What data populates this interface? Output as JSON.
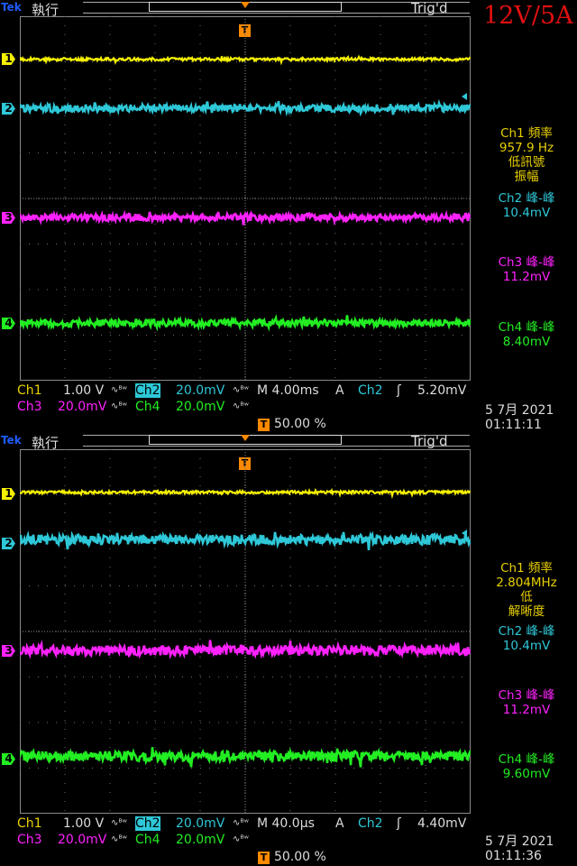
{
  "screens": [
    {
      "brand": "Tek",
      "acq_state": "執行",
      "trigger_state": "Trig'd",
      "rating_label": "12V/5A",
      "channels": [
        {
          "num": "1",
          "color": "#f5f000",
          "level": 0.118
        },
        {
          "num": "2",
          "color": "#2ec8d8",
          "level": 0.252
        },
        {
          "num": "3",
          "color": "#ff22ff",
          "level": 0.552
        },
        {
          "num": "4",
          "color": "#22ee22",
          "level": 0.842
        }
      ],
      "measurements": [
        {
          "lines": [
            "Ch1 頻率",
            "957.9 Hz",
            "低訊號",
            "振幅"
          ],
          "color": "#e8d000"
        },
        {
          "lines": [
            "Ch2 峰-峰",
            "10.4mV"
          ],
          "color": "#2ec8d8"
        },
        {
          "lines": [
            "Ch3 峰-峰",
            "11.2mV"
          ],
          "color": "#ff22ff"
        },
        {
          "lines": [
            "Ch4 峰-峰",
            "8.40mV"
          ],
          "color": "#22ee22"
        }
      ],
      "status": {
        "ch1_label": "Ch1",
        "ch1_scale": "1.00 V",
        "ch2_label": "Ch2",
        "ch2_scale": "20.0mV",
        "ch3_label": "Ch3",
        "ch3_scale": "20.0mV",
        "ch4_label": "Ch4",
        "ch4_scale": "20.0mV",
        "bw_symbol": "∿ᴮʷ",
        "timebase": "M 4.00ms",
        "trigger_mode": "A",
        "trigger_source": "Ch2",
        "trigger_slope": "ʃ",
        "trigger_level": "5.20mV",
        "position": "50.00 %",
        "date": "5 7月  2021",
        "time": "01:11:11"
      }
    },
    {
      "brand": "Tek",
      "acq_state": "執行",
      "trigger_state": "Trig'd",
      "rating_label": "",
      "channels": [
        {
          "num": "1",
          "color": "#f5f000",
          "level": 0.118
        },
        {
          "num": "2",
          "color": "#2ec8d8",
          "level": 0.248
        },
        {
          "num": "3",
          "color": "#ff22ff",
          "level": 0.552
        },
        {
          "num": "4",
          "color": "#22ee22",
          "level": 0.842
        }
      ],
      "measurements": [
        {
          "lines": [
            "Ch1 頻率",
            "2.804MHz",
            "低",
            "解晰度"
          ],
          "color": "#e8d000"
        },
        {
          "lines": [
            "Ch2 峰-峰",
            "10.4mV"
          ],
          "color": "#2ec8d8"
        },
        {
          "lines": [
            "Ch3 峰-峰",
            "11.2mV"
          ],
          "color": "#ff22ff"
        },
        {
          "lines": [
            "Ch4 峰-峰",
            "9.60mV"
          ],
          "color": "#22ee22"
        }
      ],
      "status": {
        "ch1_label": "Ch1",
        "ch1_scale": "1.00 V",
        "ch2_label": "Ch2",
        "ch2_scale": "20.0mV",
        "ch3_label": "Ch3",
        "ch3_scale": "20.0mV",
        "ch4_label": "Ch4",
        "ch4_scale": "20.0mV",
        "bw_symbol": "∿ᴮʷ",
        "timebase": "M 40.0µs",
        "trigger_mode": "A",
        "trigger_source": "Ch2",
        "trigger_slope": "ʃ",
        "trigger_level": "4.40mV",
        "position": "50.00 %",
        "date": "5 7月  2021",
        "time": "01:11:36"
      }
    }
  ]
}
